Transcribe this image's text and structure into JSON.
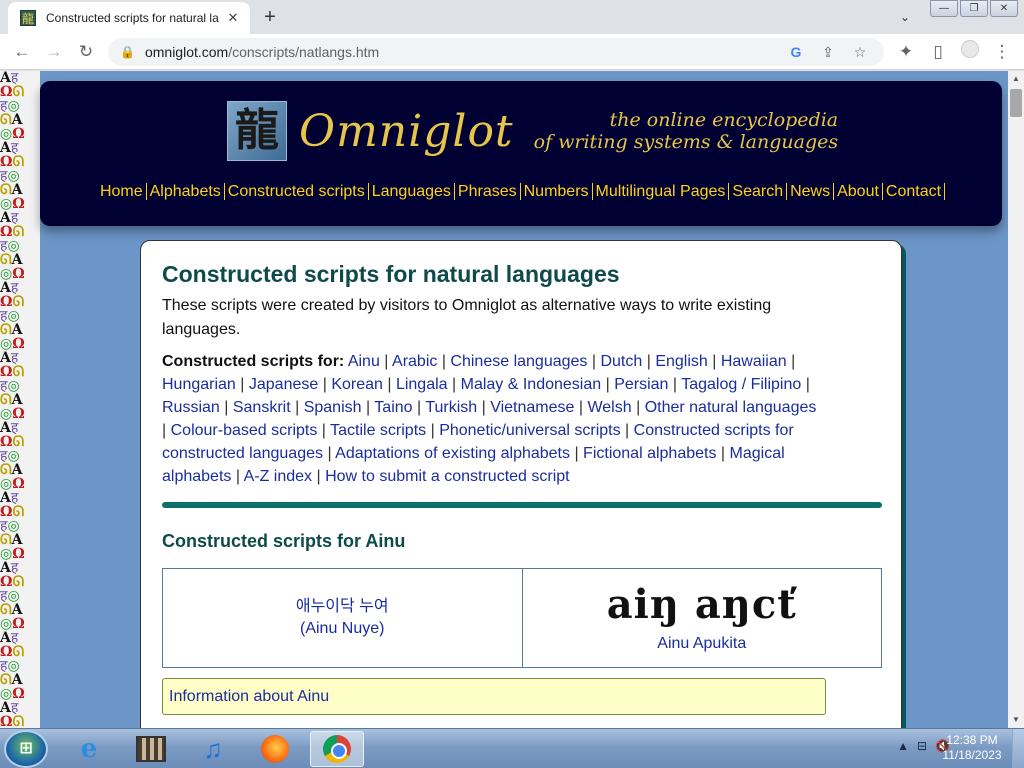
{
  "browser": {
    "tab_title": "Constructed scripts for natural la",
    "tab_close": "✕",
    "new_tab": "+",
    "tab_search": "⌄",
    "window_buttons": [
      "—",
      "❐",
      "✕"
    ],
    "nav": {
      "back": "←",
      "forward": "→",
      "reload": "↻"
    },
    "url_domain": "omniglot.com",
    "url_path": "/conscripts/natlangs.htm",
    "omnibox_icons": [
      "G",
      "⇪",
      "☆"
    ],
    "toolbar_icons": [
      "✦",
      "▯",
      "⋮"
    ]
  },
  "site": {
    "logo_text": "Omniglot",
    "logo_glyph": "龍",
    "tagline_1": "the online encyclopedia",
    "tagline_2": "of writing systems & languages",
    "nav": [
      "Home",
      "Alphabets",
      "Constructed scripts",
      "Languages",
      "Phrases",
      "Numbers",
      "Multilingual Pages",
      "Search",
      "News",
      "About",
      "Contact"
    ]
  },
  "page": {
    "title": "Constructed scripts for natural languages",
    "intro": "These scripts were created by visitors to Omniglot as alternative ways to write existing languages.",
    "links_label": "Constructed scripts for:",
    "links": [
      "Ainu",
      "Arabic",
      "Chinese languages",
      "Dutch",
      "English",
      "Hawaiian",
      "Hungarian",
      "Japanese",
      "Korean",
      "Lingala",
      "Malay & Indonesian",
      "Persian",
      "Tagalog / Filipino",
      "Russian",
      "Sanskrit",
      "Spanish",
      "Taino",
      "Turkish",
      "Vietnamese",
      "Welsh",
      "Other natural languages",
      "Colour-based scripts",
      "Tactile scripts",
      "Phonetic/universal scripts",
      "Constructed scripts for constructed languages",
      "Adaptations of existing alphabets",
      "Fictional alphabets",
      "Magical alphabets",
      "A-Z index",
      "How to submit a constructed script"
    ],
    "section_title": "Constructed scripts for Ainu",
    "script1_line1": "애누이닥 누여",
    "script1_line2": "(Ainu Nuye)",
    "script2_image_text": "aiŋ aŋcť",
    "script2_name": "Ainu Apukita",
    "info_link": "Information about Ainu"
  },
  "taskbar": {
    "start_label": "⊞",
    "apps": [
      "internet-explorer",
      "media-center",
      "itunes",
      "firefox",
      "chrome"
    ],
    "ie_glyph": "e",
    "music_glyph": "♫",
    "tray_icons": [
      "▲",
      "⊟",
      "🔇"
    ],
    "time": "12:38 PM",
    "date": "11/18/2023"
  }
}
